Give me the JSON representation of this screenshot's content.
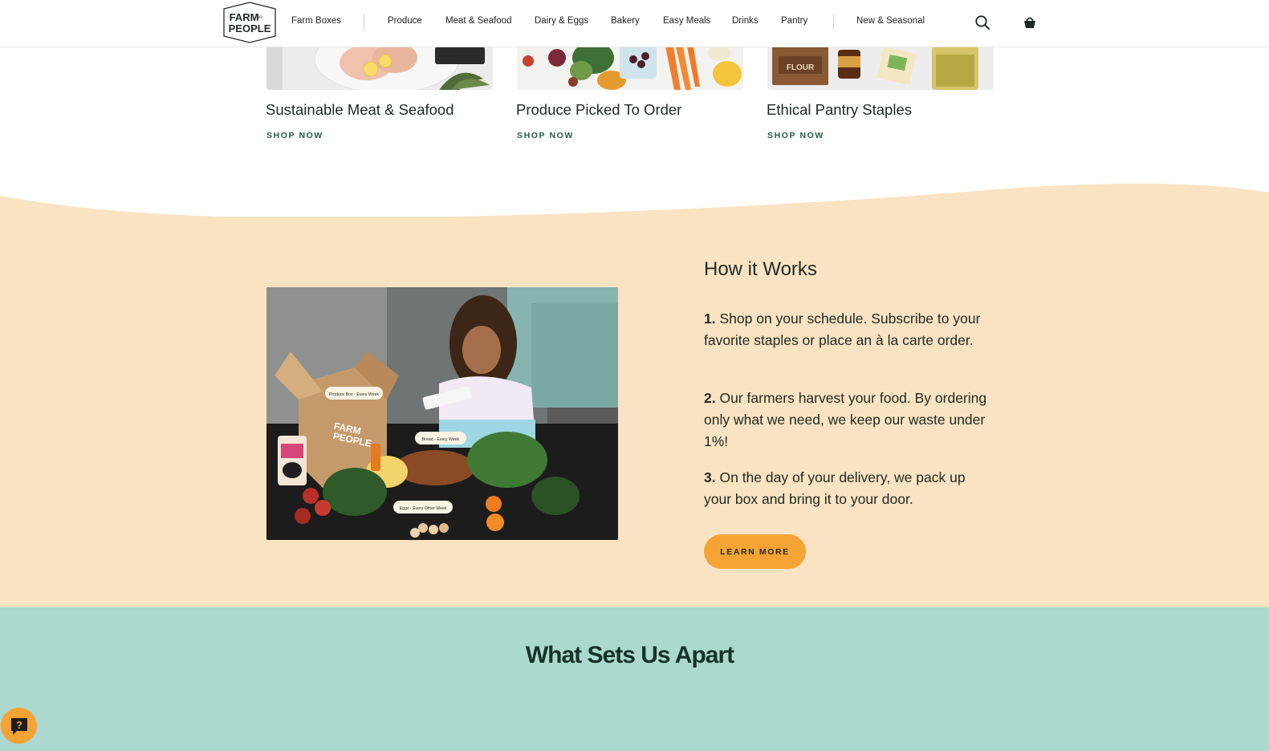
{
  "header": {
    "logo": {
      "line1": "FARM",
      "amp": "to",
      "line2": "PEOPLE"
    },
    "nav": [
      "Farm Boxes",
      "Produce",
      "Meat & Seafood",
      "Dairy & Eggs",
      "Bakery",
      "Easy Meals",
      "Drinks",
      "Pantry",
      "New & Seasonal"
    ],
    "icons": {
      "search": "search-icon",
      "cart": "basket-icon"
    }
  },
  "categories": [
    {
      "title": "Sustainable Meat & Seafood",
      "link": "SHOP NOW"
    },
    {
      "title": "Produce Picked To Order",
      "link": "SHOP NOW"
    },
    {
      "title": "Ethical Pantry Staples",
      "link": "SHOP NOW"
    }
  ],
  "how": {
    "title": "How it Works",
    "steps": [
      {
        "num": "1.",
        "text": "Shop on your schedule. Subscribe to your favorite staples or place an à la carte order."
      },
      {
        "num": "2.",
        "text": "Our farmers harvest your food. By ordering only what we need, we keep our waste under 1%!"
      },
      {
        "num": "3.",
        "text": "On the day of your delivery, we pack up your box and bring it to your door."
      }
    ],
    "button": "LEARN MORE",
    "photo_labels": {
      "produce": "Produce Box - Every Week",
      "bread": "Bread - Every Week",
      "eggs": "Eggs - Every Other Week",
      "box_logo_1": "FARM",
      "box_logo_2": "PEOPLE"
    }
  },
  "apart": {
    "title": "What Sets Us Apart"
  },
  "help": {
    "glyph": "?"
  },
  "colors": {
    "accent_orange": "#f6a335",
    "cream": "#fae3c2",
    "mint": "#abd8cf",
    "link_green": "#1e5e3e"
  }
}
